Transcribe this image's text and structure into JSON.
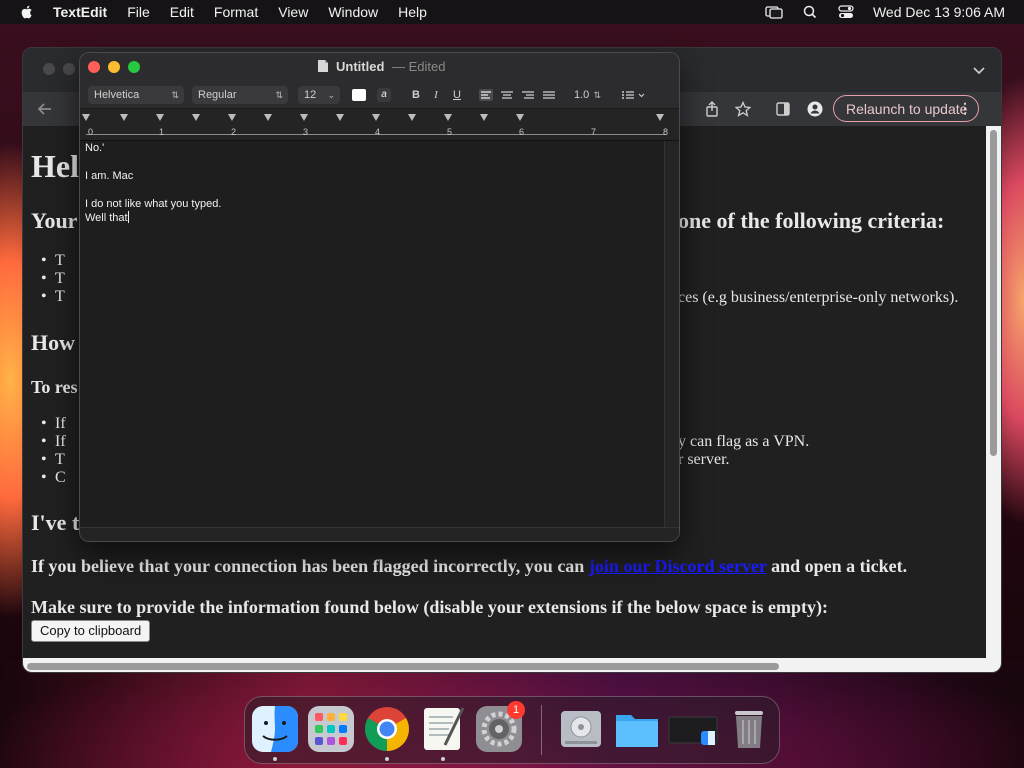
{
  "menubar": {
    "app_name": "TextEdit",
    "menus": [
      "File",
      "Edit",
      "Format",
      "View",
      "Window",
      "Help"
    ],
    "clock": "Wed Dec 13  9:06 AM"
  },
  "chrome": {
    "relaunch_label": "Relaunch to update",
    "page": {
      "heading_fragment": "Hel",
      "subheading_left": "Your",
      "subheading_right": "one of the following criteria:",
      "bullets_a": [
        "T",
        "T",
        "T"
      ],
      "bullet_a3_tail": "ces (e.g business/enterprise-only networks).",
      "section_how": "How",
      "section_resolve": "To res",
      "bullets_b": [
        "If",
        "If",
        "T",
        "C"
      ],
      "bullet_b2_tail": "y can flag as a VPN.",
      "bullet_b3_tail": "r server.",
      "section_ive": "I've t",
      "flag_text_before": "If you believe that your connection has been flagged incorrectly, you can",
      "flag_link": "join our Discord server",
      "flag_text_after": "and open a ticket.",
      "provide_text": "Make sure to provide the information found below (disable your extensions if the below space is empty):",
      "copy_button": "Copy to clipboard"
    }
  },
  "textedit": {
    "title": "Untitled",
    "title_suffix": "— Edited",
    "font_family": "Helvetica",
    "font_style": "Regular",
    "font_size": "12",
    "style_buttons": [
      "B",
      "I",
      "U"
    ],
    "line_spacing": "1.0",
    "ruler_numbers": [
      "0",
      "1",
      "2",
      "3",
      "4",
      "5",
      "6",
      "7",
      "8"
    ],
    "lines": [
      "No.'",
      "",
      "I am. Mac",
      "",
      "I do not like what you typed.",
      "Well that"
    ]
  },
  "dock": {
    "items": [
      "finder-icon",
      "launchpad-icon",
      "chrome-icon",
      "textedit-icon",
      "system-settings-icon",
      "disk-utility-icon",
      "folder-icon",
      "finder-window-icon",
      "trash-icon"
    ],
    "settings_badge": "1"
  }
}
